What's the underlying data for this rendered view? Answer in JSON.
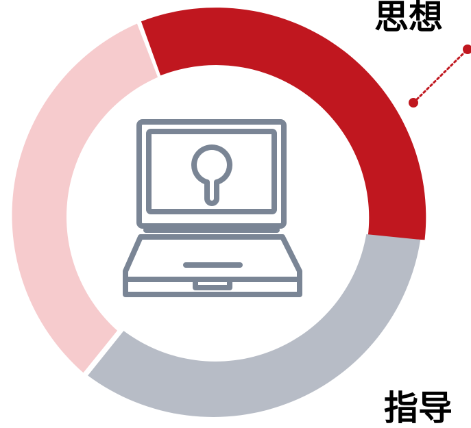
{
  "labels": {
    "top": "思想",
    "bottom": "指导"
  },
  "ring_segments": [
    {
      "name": "red-segment",
      "color": "#c0171f"
    },
    {
      "name": "gray-segment",
      "color": "#b7bcc6"
    },
    {
      "name": "pink-segment",
      "color": "#f6cbcd"
    }
  ],
  "colors": {
    "accent_red": "#c0171f",
    "icon_stroke": "#7a8595",
    "background": "#ffffff"
  },
  "icon": "laptop-keyhole-icon"
}
